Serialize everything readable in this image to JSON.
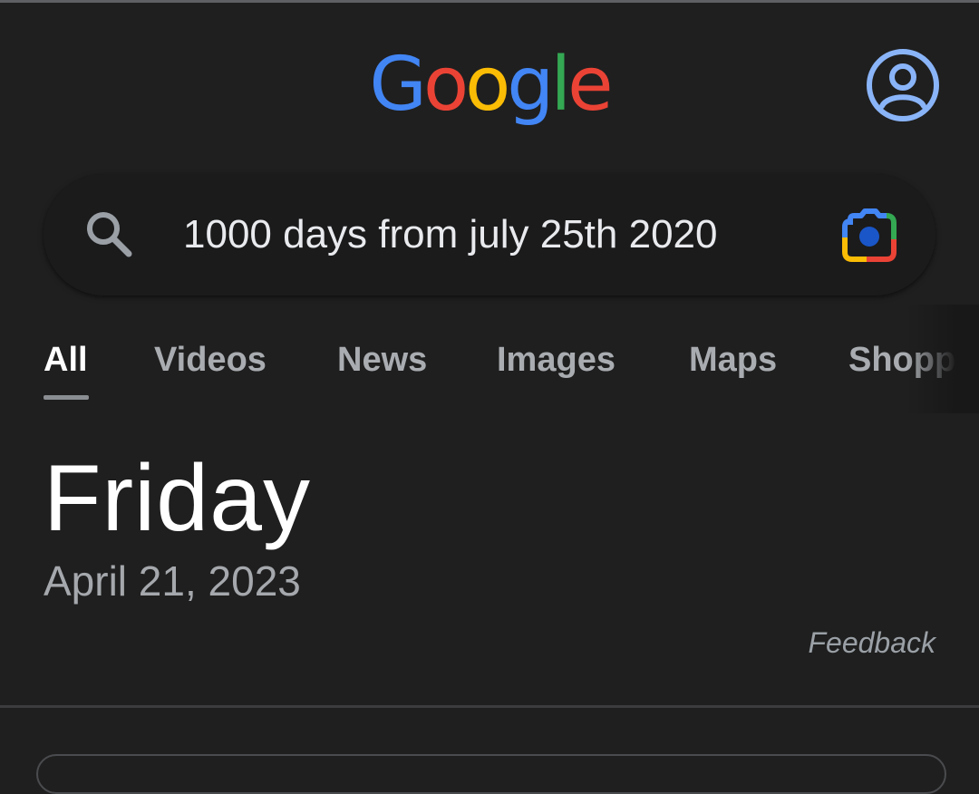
{
  "header": {
    "logo_letters": [
      {
        "char": "G",
        "color": "#4285f4"
      },
      {
        "char": "o",
        "color": "#ea4335"
      },
      {
        "char": "o",
        "color": "#fbbc05"
      },
      {
        "char": "g",
        "color": "#4285f4"
      },
      {
        "char": "l",
        "color": "#34a853"
      },
      {
        "char": "e",
        "color": "#ea4335"
      }
    ],
    "account_icon": "account-circle-icon",
    "account_color": "#8ab4f8"
  },
  "search": {
    "query": "1000 days from july 25th 2020",
    "search_icon": "magnifier-icon",
    "lens_icon": "google-lens-camera-icon"
  },
  "tabs": [
    {
      "label": "All",
      "active": true
    },
    {
      "label": "Videos",
      "active": false
    },
    {
      "label": "News",
      "active": false
    },
    {
      "label": "Images",
      "active": false
    },
    {
      "label": "Maps",
      "active": false
    },
    {
      "label": "Shoppi",
      "active": false
    }
  ],
  "result": {
    "day": "Friday",
    "date": "April 21, 2023",
    "feedback_label": "Feedback"
  },
  "colors": {
    "background": "#1f1f1f",
    "text_primary": "#ffffff",
    "text_secondary": "#a5a8ac"
  }
}
